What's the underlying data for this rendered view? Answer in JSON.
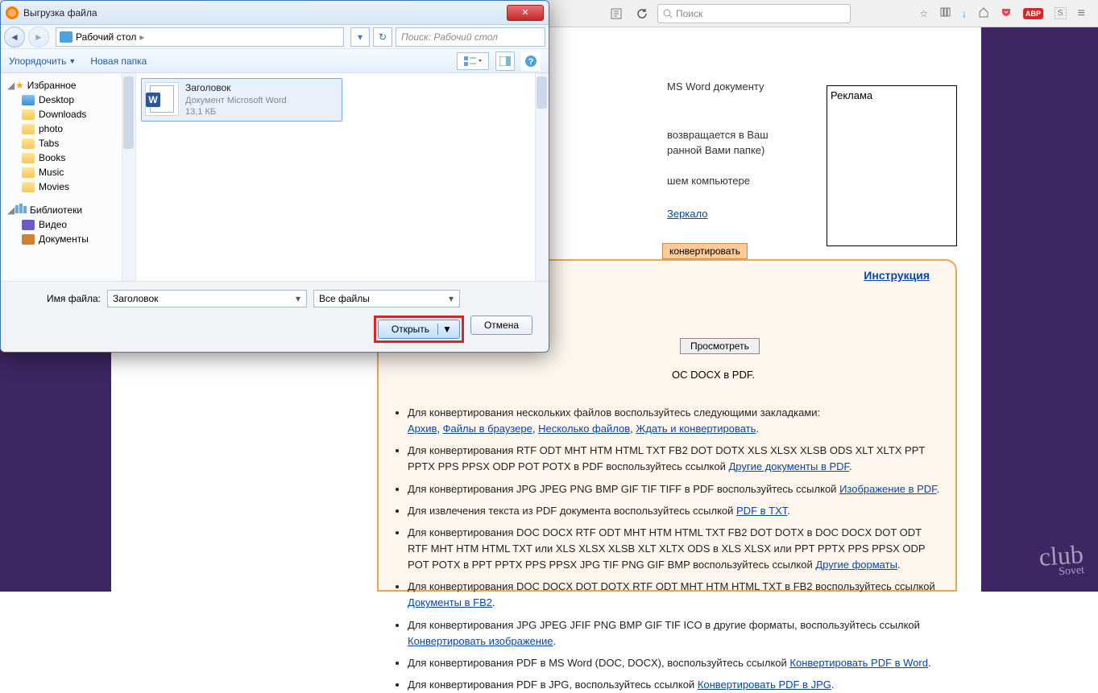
{
  "browser": {
    "search_placeholder": "Поиск",
    "reader_icon": "reader",
    "reload_icon": "reload"
  },
  "page": {
    "snippet_line1": "MS Word документу",
    "snippet_line2": "возвращается в Ваш",
    "snippet_line3": "ранной Вами папке)",
    "snippet_line4": "шем компьютере",
    "mirror": "Зеркало",
    "convert": "конвертировать",
    "ad_label": "Реклама",
    "instruction": "Инструкция",
    "browse": "Просмотреть",
    "docx_line": "OC DOCX в PDF.",
    "arrow": "»"
  },
  "bullets": [
    {
      "t": "Для конвертирования нескольких файлов воспользуйтесь следующими закладками:",
      "links": [
        "Архив",
        "Файлы в браузере",
        "Несколько файлов",
        "Ждать и конвертировать"
      ],
      "sep": ", ",
      "tail": "."
    },
    {
      "t": "Для конвертирования RTF ODT MHT HTM HTML TXT FB2 DOT DOTX XLS XLSX XLSB ODS XLT XLTX PPT PPTX PPS PPSX ODP POT POTX в PDF воспользуйтесь ссылкой ",
      "links": [
        "Другие документы в PDF"
      ],
      "tail": "."
    },
    {
      "t": "Для конвертирования JPG JPEG PNG BMP GIF TIF TIFF в PDF воспользуйтесь ссылкой ",
      "links": [
        "Изображение в PDF"
      ],
      "tail": "."
    },
    {
      "t": "Для извлечения текста из PDF документа воспользуйтесь ссылкой ",
      "links": [
        "PDF в TXT"
      ],
      "tail": "."
    },
    {
      "t": "Для конвертирования DOC DOCX RTF ODT MHT HTM HTML TXT FB2 DOT DOTX в DOC DOCX DOT ODT RTF MHT HTM HTML TXT или XLS XLSX XLSB XLT XLTX ODS в XLS XLSX или PPT PPTX PPS PPSX ODP POT POTX в PPT PPTX PPS PPSX JPG TIF PNG GIF BMP воспользуйтесь ссылкой ",
      "links": [
        "Другие форматы"
      ],
      "tail": "."
    },
    {
      "t": "Для конвертирования DOC DOCX DOT DOTX RTF ODT MHT HTM HTML TXT в FB2 воспользуйтесь ссылкой ",
      "links": [
        "Документы в FB2"
      ],
      "tail": "."
    },
    {
      "t": "Для конвертирования JPG JPEG JFIF PNG BMP GIF TIF ICO в другие форматы, воспользуйтесь ссылкой ",
      "links": [
        "Конвертировать изображение"
      ],
      "tail": "."
    },
    {
      "t": "Для конвертирования PDF в MS Word (DOC, DOCX), воспользуйтесь ссылкой ",
      "links": [
        "Конвертировать PDF в Word"
      ],
      "tail": "."
    },
    {
      "t": "Для конвертирования PDF в JPG, воспользуйтесь ссылкой ",
      "links": [
        "Конвертировать PDF в JPG"
      ],
      "tail": "."
    }
  ],
  "watermark": {
    "top": "club",
    "bottom": "Sovet"
  },
  "dialog": {
    "title": "Выгрузка файла",
    "breadcrumb": "Рабочий стол",
    "search_placeholder": "Поиск: Рабочий стол",
    "organize": "Упорядочить",
    "new_folder": "Новая папка",
    "favorites": "Избранное",
    "fav_items": [
      "Desktop",
      "Downloads",
      "photo",
      "Tabs",
      "Books",
      "Music",
      "Movies"
    ],
    "libraries": "Библиотеки",
    "lib_items": [
      "Видео",
      "Документы"
    ],
    "file": {
      "name": "Заголовок",
      "type": "Документ Microsoft Word",
      "size": "13,1 КБ"
    },
    "filename_label": "Имя файла:",
    "filename_value": "Заголовок",
    "filter": "Все файлы",
    "open": "Открыть",
    "cancel": "Отмена"
  }
}
